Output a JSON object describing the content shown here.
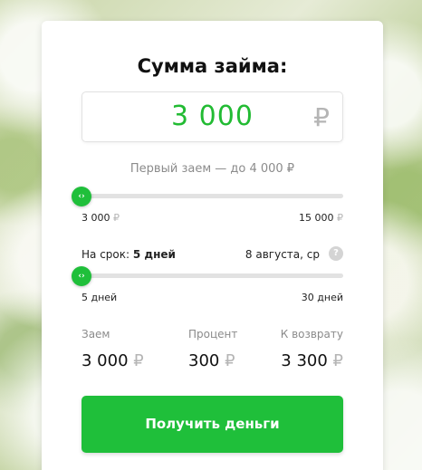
{
  "title": "Сумма займа:",
  "amount": {
    "value": "3 000",
    "currency": "₽"
  },
  "first_loan_note": "Первый заем — до 4 000 ₽",
  "amount_slider": {
    "min_label": "3 000",
    "max_label": "15 000",
    "currency": "₽",
    "fraction": 0.0,
    "thumb_glyph": "‹›"
  },
  "term": {
    "label": "На срок:",
    "value": "5 дней",
    "date": "8 августа, ср",
    "help_glyph": "?"
  },
  "term_slider": {
    "min_label": "5 дней",
    "max_label": "30 дней",
    "fraction": 0.0,
    "thumb_glyph": "‹›"
  },
  "summary": {
    "loan_label": "Заем",
    "loan_value": "3 000",
    "interest_label": "Процент",
    "interest_value": "300",
    "repay_label": "К возврату",
    "repay_value": "3 300",
    "currency": "₽"
  },
  "cta_label": "Получить деньги",
  "colors": {
    "accent": "#1fbf3a",
    "amount_text": "#22bb33",
    "muted": "#8b8b8b"
  }
}
